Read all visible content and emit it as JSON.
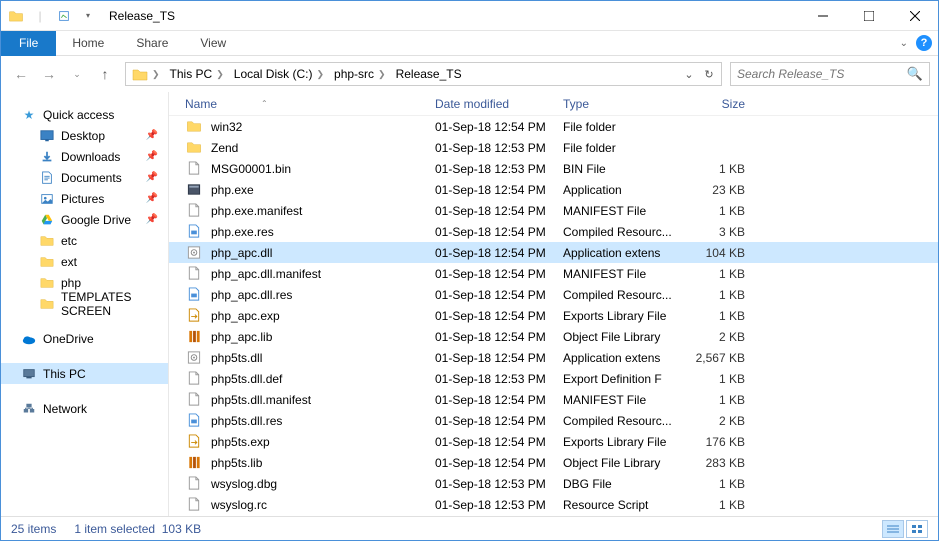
{
  "title": "Release_TS",
  "ribbon": {
    "file": "File",
    "tabs": [
      "Home",
      "Share",
      "View"
    ]
  },
  "breadcrumbs": [
    "This PC",
    "Local Disk (C:)",
    "php-src",
    "Release_TS"
  ],
  "search_placeholder": "Search Release_TS",
  "navpane": {
    "quick_access": {
      "label": "Quick access",
      "items": [
        {
          "label": "Desktop",
          "pinned": true,
          "icon": "desktop"
        },
        {
          "label": "Downloads",
          "pinned": true,
          "icon": "downloads"
        },
        {
          "label": "Documents",
          "pinned": true,
          "icon": "documents"
        },
        {
          "label": "Pictures",
          "pinned": true,
          "icon": "pictures"
        },
        {
          "label": "Google Drive",
          "pinned": true,
          "icon": "gdrive"
        },
        {
          "label": "etc",
          "pinned": false,
          "icon": "folder"
        },
        {
          "label": "ext",
          "pinned": false,
          "icon": "folder"
        },
        {
          "label": "php",
          "pinned": false,
          "icon": "folder"
        },
        {
          "label": "TEMPLATES SCREEN",
          "pinned": false,
          "icon": "folder"
        }
      ]
    },
    "onedrive": "OneDrive",
    "thispc": "This PC",
    "network": "Network"
  },
  "columns": {
    "name": "Name",
    "date": "Date modified",
    "type": "Type",
    "size": "Size"
  },
  "files": [
    {
      "name": "win32",
      "date": "01-Sep-18 12:54 PM",
      "type": "File folder",
      "size": "",
      "icon": "folder"
    },
    {
      "name": "Zend",
      "date": "01-Sep-18 12:53 PM",
      "type": "File folder",
      "size": "",
      "icon": "folder"
    },
    {
      "name": "MSG00001.bin",
      "date": "01-Sep-18 12:53 PM",
      "type": "BIN File",
      "size": "1 KB",
      "icon": "file"
    },
    {
      "name": "php.exe",
      "date": "01-Sep-18 12:54 PM",
      "type": "Application",
      "size": "23 KB",
      "icon": "app"
    },
    {
      "name": "php.exe.manifest",
      "date": "01-Sep-18 12:54 PM",
      "type": "MANIFEST File",
      "size": "1 KB",
      "icon": "file"
    },
    {
      "name": "php.exe.res",
      "date": "01-Sep-18 12:54 PM",
      "type": "Compiled Resourc...",
      "size": "3 KB",
      "icon": "res"
    },
    {
      "name": "php_apc.dll",
      "date": "01-Sep-18 12:54 PM",
      "type": "Application extens",
      "size": "104 KB",
      "icon": "dll",
      "selected": true
    },
    {
      "name": "php_apc.dll.manifest",
      "date": "01-Sep-18 12:54 PM",
      "type": "MANIFEST File",
      "size": "1 KB",
      "icon": "file"
    },
    {
      "name": "php_apc.dll.res",
      "date": "01-Sep-18 12:54 PM",
      "type": "Compiled Resourc...",
      "size": "1 KB",
      "icon": "res"
    },
    {
      "name": "php_apc.exp",
      "date": "01-Sep-18 12:54 PM",
      "type": "Exports Library File",
      "size": "1 KB",
      "icon": "exp"
    },
    {
      "name": "php_apc.lib",
      "date": "01-Sep-18 12:54 PM",
      "type": "Object File Library",
      "size": "2 KB",
      "icon": "lib"
    },
    {
      "name": "php5ts.dll",
      "date": "01-Sep-18 12:54 PM",
      "type": "Application extens",
      "size": "2,567 KB",
      "icon": "dll"
    },
    {
      "name": "php5ts.dll.def",
      "date": "01-Sep-18 12:53 PM",
      "type": "Export Definition F",
      "size": "1 KB",
      "icon": "file"
    },
    {
      "name": "php5ts.dll.manifest",
      "date": "01-Sep-18 12:54 PM",
      "type": "MANIFEST File",
      "size": "1 KB",
      "icon": "file"
    },
    {
      "name": "php5ts.dll.res",
      "date": "01-Sep-18 12:54 PM",
      "type": "Compiled Resourc...",
      "size": "2 KB",
      "icon": "res"
    },
    {
      "name": "php5ts.exp",
      "date": "01-Sep-18 12:54 PM",
      "type": "Exports Library File",
      "size": "176 KB",
      "icon": "exp"
    },
    {
      "name": "php5ts.lib",
      "date": "01-Sep-18 12:54 PM",
      "type": "Object File Library",
      "size": "283 KB",
      "icon": "lib"
    },
    {
      "name": "wsyslog.dbg",
      "date": "01-Sep-18 12:53 PM",
      "type": "DBG File",
      "size": "1 KB",
      "icon": "file"
    },
    {
      "name": "wsyslog.rc",
      "date": "01-Sep-18 12:53 PM",
      "type": "Resource Script",
      "size": "1 KB",
      "icon": "file"
    }
  ],
  "status": {
    "items": "25 items",
    "selected": "1 item selected",
    "size": "103 KB"
  }
}
